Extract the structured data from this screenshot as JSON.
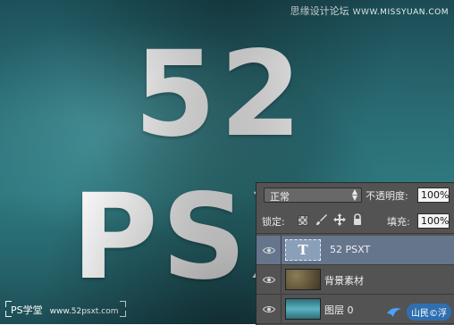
{
  "canvas": {
    "big_text_line1": "52",
    "big_text_line2": "PSXT",
    "watermark_top": "思缘设计论坛",
    "watermark_top_url": "WWW.MISSYUAN.COM",
    "brand_left": "PS学堂",
    "brand_left_site": "www.52psxt.com"
  },
  "layers_panel": {
    "blend_mode": "正常",
    "opacity_label": "不透明度:",
    "opacity_value": "100%",
    "lock_label": "锁定:",
    "fill_label": "填充:",
    "fill_value": "100%",
    "layers": [
      {
        "name": "52 PSXT",
        "thumb": "T",
        "selected": true,
        "type": "text"
      },
      {
        "name": "背景素材",
        "selected": false,
        "type": "image"
      },
      {
        "name": "图层 0",
        "selected": false,
        "type": "image"
      }
    ],
    "footer_badge": "山民©浮"
  },
  "colors": {
    "selected_layer": "#65758c",
    "panel_bg": "#535353",
    "canvas_teal": "#2f7b80"
  },
  "icons": [
    "eye-icon",
    "transparency-lock-icon",
    "brush-lock-icon",
    "move-lock-icon",
    "padlock-icon"
  ]
}
